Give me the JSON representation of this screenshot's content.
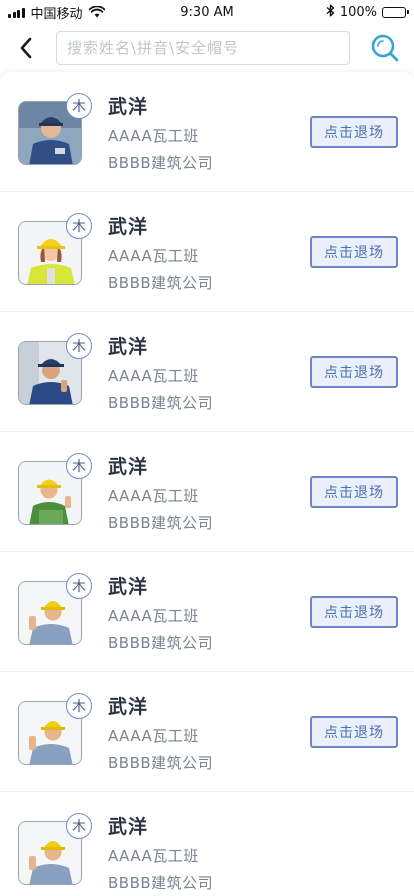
{
  "status_bar": {
    "carrier": "中国移动",
    "time": "9:30 AM",
    "battery": "100%"
  },
  "search": {
    "placeholder": "搜索姓名\\拼音\\安全帽号",
    "value": ""
  },
  "icons": {
    "back": "chevron-left-icon",
    "search": "search-icon",
    "signal": "signal-icon",
    "wifi": "wifi-icon",
    "bluetooth": "bluetooth-icon",
    "battery": "battery-icon"
  },
  "colors": {
    "accent": "#6f84c7",
    "search_icon": "#3aa3d6",
    "button_bg": "#eaf0fb",
    "badge_border": "#6d8ec9"
  },
  "workers": [
    {
      "name": "武洋",
      "badge": "木",
      "team": "AAAA瓦工班",
      "company": "BBBB建筑公司",
      "action": "点击退场"
    },
    {
      "name": "武洋",
      "badge": "木",
      "team": "AAAA瓦工班",
      "company": "BBBB建筑公司",
      "action": "点击退场"
    },
    {
      "name": "武洋",
      "badge": "木",
      "team": "AAAA瓦工班",
      "company": "BBBB建筑公司",
      "action": "点击退场"
    },
    {
      "name": "武洋",
      "badge": "木",
      "team": "AAAA瓦工班",
      "company": "BBBB建筑公司",
      "action": "点击退场"
    },
    {
      "name": "武洋",
      "badge": "木",
      "team": "AAAA瓦工班",
      "company": "BBBB建筑公司",
      "action": "点击退场"
    },
    {
      "name": "武洋",
      "badge": "木",
      "team": "AAAA瓦工班",
      "company": "BBBB建筑公司",
      "action": "点击退场"
    },
    {
      "name": "武洋",
      "badge": "木",
      "team": "AAAA瓦工班",
      "company": "BBBB建筑公司",
      "action": ""
    }
  ]
}
